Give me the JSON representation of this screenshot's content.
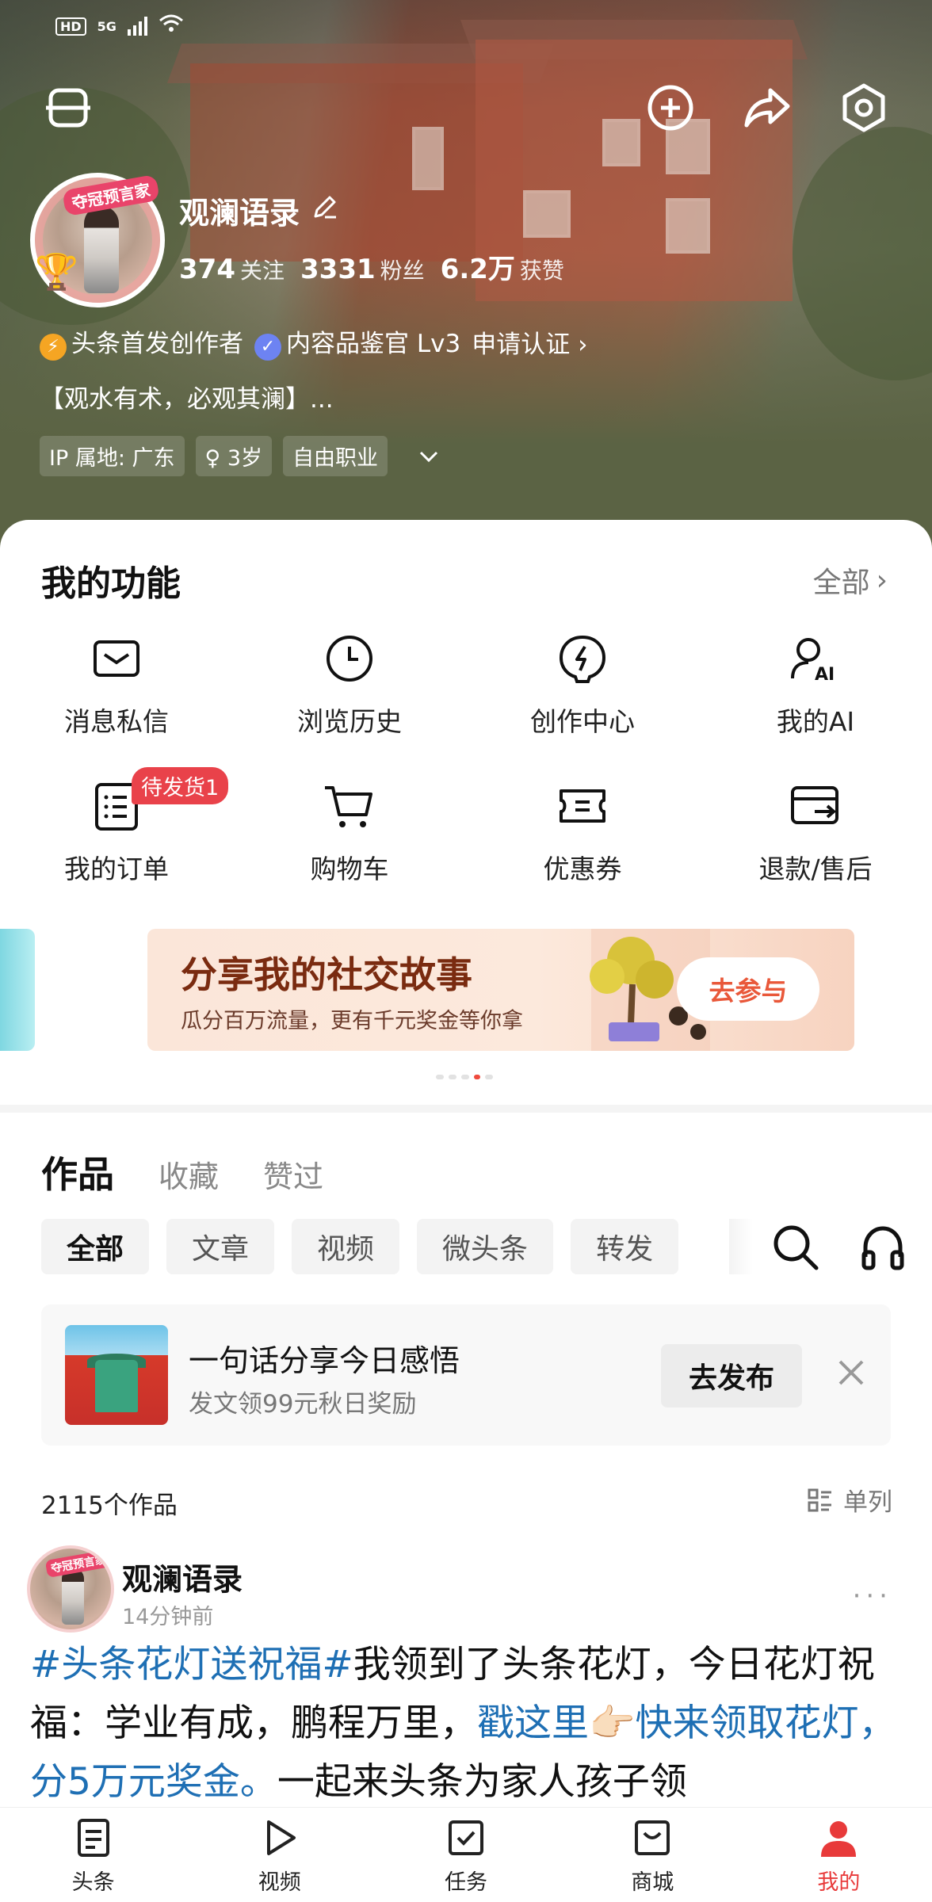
{
  "status_bar": {
    "hd": "HD",
    "net": "5G"
  },
  "profile": {
    "name": "观澜语录",
    "avatar_badge": "夺冠预言家",
    "stats": [
      {
        "num": "374",
        "label": "关注"
      },
      {
        "num": "3331",
        "label": "粉丝"
      },
      {
        "num": "6.2万",
        "label": "获赞"
      }
    ],
    "badges": [
      {
        "label": "头条首发创作者",
        "color": "#f5a523"
      },
      {
        "label": "内容品鉴官 Lv3",
        "color": "#6d83f2"
      }
    ],
    "certify": "申请认证",
    "bio": "【观水有术，必观其澜】...",
    "tags": [
      "IP 属地: 广东",
      "♀ 3岁",
      "自由职业"
    ]
  },
  "functions": {
    "title": "我的功能",
    "all": "全部",
    "items": [
      {
        "label": "消息私信",
        "icon": "mail-icon"
      },
      {
        "label": "浏览历史",
        "icon": "clock-icon"
      },
      {
        "label": "创作中心",
        "icon": "create-icon"
      },
      {
        "label": "我的AI",
        "icon": "ai-icon"
      },
      {
        "label": "我的订单",
        "icon": "order-icon",
        "badge": "待发货1"
      },
      {
        "label": "购物车",
        "icon": "cart-icon"
      },
      {
        "label": "优惠券",
        "icon": "coupon-icon"
      },
      {
        "label": "退款/售后",
        "icon": "refund-icon"
      }
    ]
  },
  "banner": {
    "title": "分享我的社交故事",
    "subtitle": "瓜分百万流量，更有千元奖金等你拿",
    "button": "去参与"
  },
  "works": {
    "tabs": [
      "作品",
      "收藏",
      "赞过"
    ],
    "chips": [
      "全部",
      "文章",
      "视频",
      "微头条",
      "转发"
    ],
    "prompt": {
      "title": "一句话分享今日感悟",
      "subtitle": "发文领99元秋日奖励",
      "button": "去发布"
    },
    "count": "2115个作品",
    "view_mode": "单列"
  },
  "post": {
    "author": "观澜语录",
    "time": "14分钟前",
    "more": "···",
    "segments": [
      {
        "text": "#头条花灯送祝福#",
        "link": true
      },
      {
        "text": "我领到了头条花灯，今日花灯祝福：学业有成，鹏程万里，",
        "link": false
      },
      {
        "text": "戳这里👉🏻快来领取花灯，分5万元奖金。",
        "link": true
      },
      {
        "text": "一起来头条为家人孩子领",
        "link": false
      }
    ]
  },
  "nav": {
    "items": [
      {
        "label": "头条",
        "icon": "news-icon"
      },
      {
        "label": "视频",
        "icon": "play-icon"
      },
      {
        "label": "任务",
        "icon": "task-icon"
      },
      {
        "label": "商城",
        "icon": "shop-icon"
      },
      {
        "label": "我的",
        "icon": "user-icon",
        "active": true
      }
    ],
    "active_color": "#e83a3a"
  }
}
